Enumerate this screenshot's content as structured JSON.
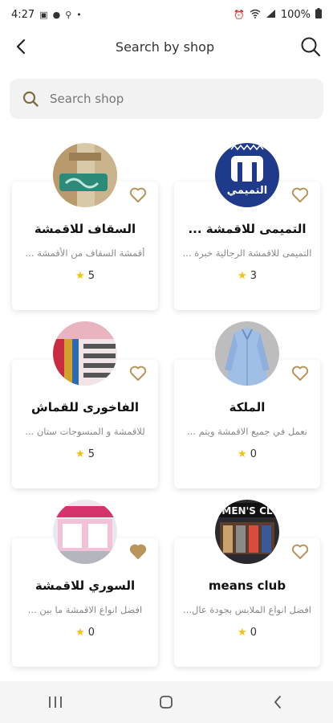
{
  "status_bar": {
    "time": "4:27",
    "battery": "100%"
  },
  "header": {
    "title": "Search by shop"
  },
  "search": {
    "placeholder": "Search shop",
    "value": ""
  },
  "shops": [
    {
      "name": "السقاف للاقمشة",
      "description": "أقمشة السقاف من الأقمشة ...",
      "rating": "5",
      "favorited": false,
      "logo": "building-interior"
    },
    {
      "name": "التميمى للاقمشة ...",
      "description": "التميمى للاقمشة الرجالية خبرة ...",
      "rating": "3",
      "favorited": false,
      "logo": "tamimi-logo",
      "logo_text": "التميمي"
    },
    {
      "name": "الفاخورى للقماش",
      "description": "للاقمشة و المنسوجات ستان ...",
      "rating": "5",
      "favorited": false,
      "logo": "fabric-shelves"
    },
    {
      "name": "الملكة",
      "description": "نعمل في جميع الاقمشة ويتم ...",
      "rating": "0",
      "favorited": false,
      "logo": "blue-shirt"
    },
    {
      "name": "السوري للاقمشة",
      "description": "افضل انواع الاقمشة ما بين ...",
      "rating": "0",
      "favorited": true,
      "logo": "shop-front-pink"
    },
    {
      "name": "means club",
      "description": "افضل انواع الملابس بجودة عال...",
      "rating": "0",
      "favorited": false,
      "logo": "dark-storefront",
      "logo_text": "MEN'S CL"
    }
  ],
  "colors": {
    "accent": "#b8955a",
    "star": "#f4c20d",
    "search_bg": "#f2f2f2",
    "search_icon": "#7a6f43"
  },
  "icons": {
    "back": "back-arrow-icon",
    "search": "search-icon",
    "favorite": "heart-icon",
    "rating": "star-icon"
  }
}
